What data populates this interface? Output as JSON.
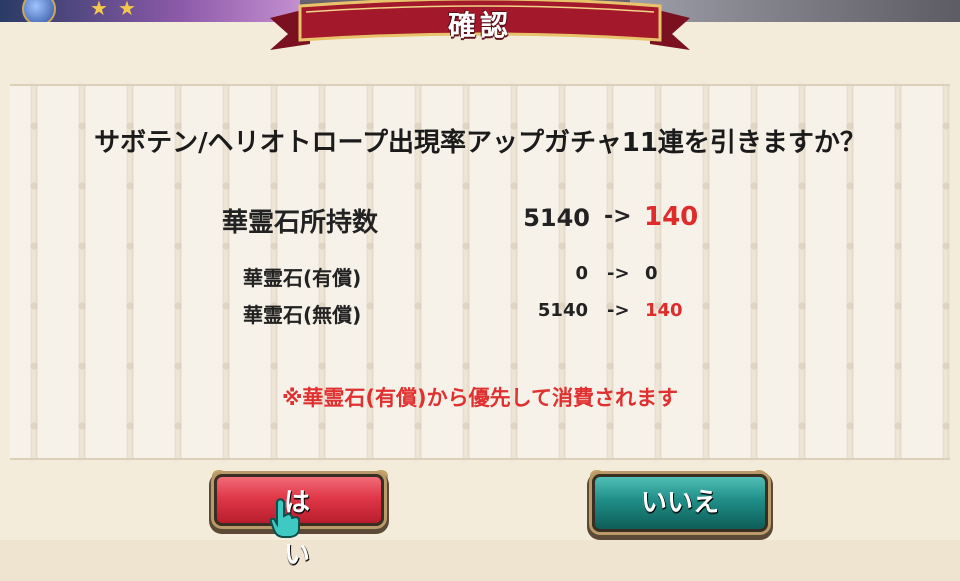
{
  "dialog": {
    "title": "確認",
    "question": "サボテン/ヘリオトロープ出現率アップガチャ11連を引きますか？",
    "stones": {
      "main": {
        "label": "華霊石所持数",
        "current": "5140",
        "arrow": "->",
        "after": "140"
      },
      "paid": {
        "label": "華霊石(有償)",
        "current": "0",
        "arrow": "->",
        "after": "0"
      },
      "free": {
        "label": "華霊石(無償)",
        "current": "5140",
        "arrow": "->",
        "after": "140"
      }
    },
    "notice": "※華霊石(有償)から優先して消費されます",
    "buttons": {
      "yes": "はい",
      "no": "いいえ"
    }
  },
  "colors": {
    "ribbon": "#a3182a",
    "warning": "#e02b2b",
    "yes_button": "#e03848",
    "no_button": "#1f8d86"
  },
  "icons": [
    "orb-icon",
    "star-icon",
    "pointing-hand-icon"
  ]
}
